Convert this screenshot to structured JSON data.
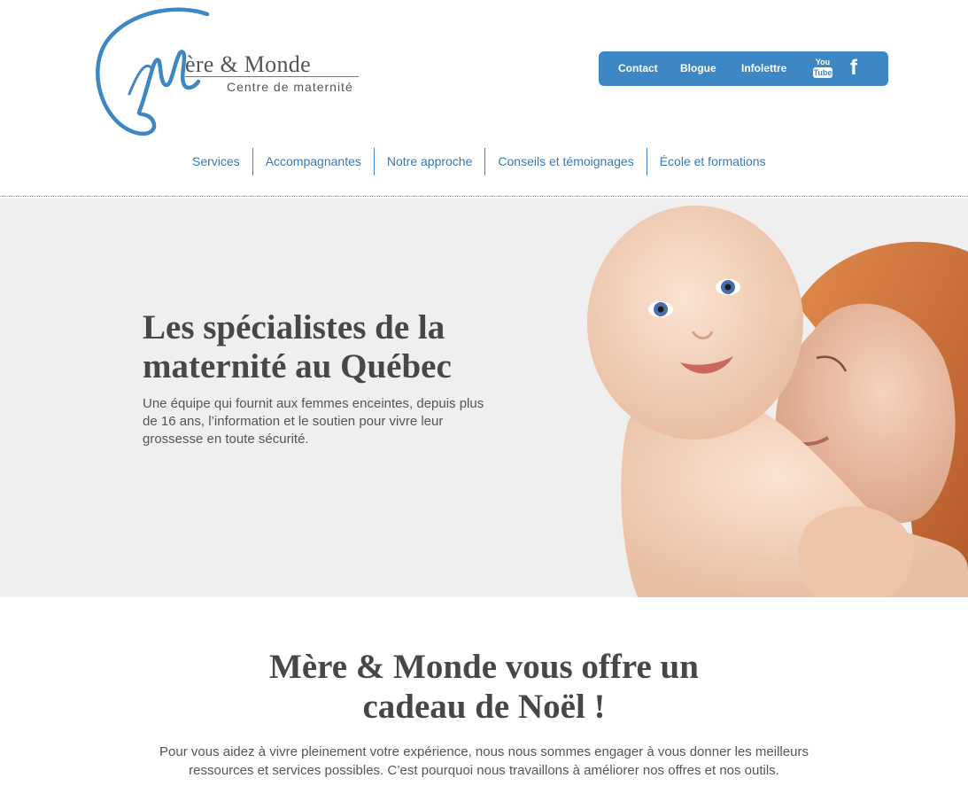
{
  "logo": {
    "title": "ère & Monde",
    "subtitle": "Centre de maternité"
  },
  "topbar": {
    "links": [
      "Contact",
      "Blogue",
      "Infolettre"
    ],
    "youtube_top": "You",
    "youtube_bottom": "Tube",
    "facebook_glyph": "f",
    "background_color": "#3d87c4"
  },
  "nav": {
    "items": [
      "Services",
      "Accompagnantes",
      "Notre approche",
      "Conseils et témoignages",
      "École et formations"
    ],
    "link_color": "#3a78b0"
  },
  "hero": {
    "title_line1": "Les spécialistes de la",
    "title_line2": "maternité au Québec",
    "text": "Une équipe qui fournit aux femmes enceintes, depuis plus de 16 ans, l’information et le soutien pour vivre leur grossesse en toute sécurité.",
    "background_color": "#efefef"
  },
  "promo": {
    "title_line1": "Mère & Monde vous offre un",
    "title_line2": "cadeau de Noël !",
    "text": "Pour vous aidez à vivre pleinement votre expérience, nous nous sommes engager à vous donner les meilleurs ressources et services possibles. C’est pourquoi nous travaillons à améliorer nos offres et nos outils."
  }
}
